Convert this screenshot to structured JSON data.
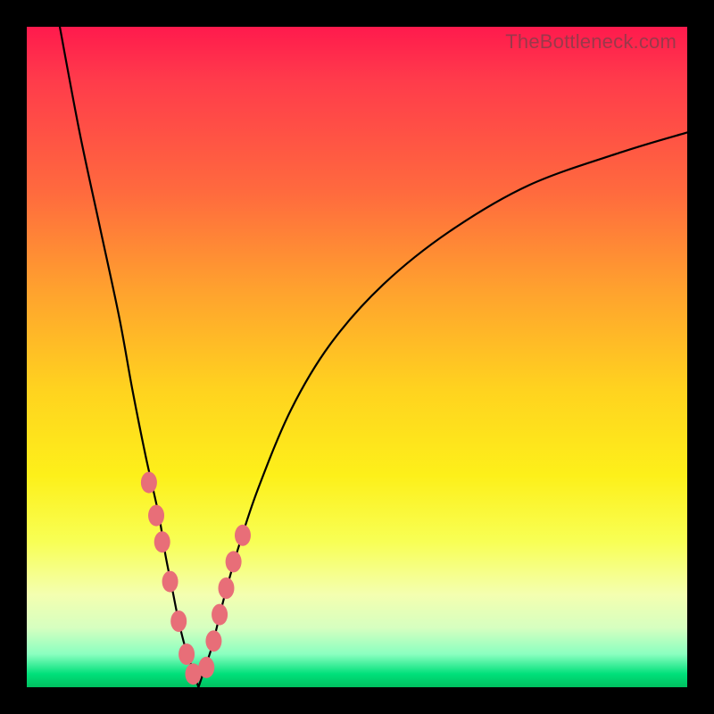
{
  "watermark": "TheBottleneck.com",
  "chart_data": {
    "type": "line",
    "title": "",
    "xlabel": "",
    "ylabel": "",
    "xlim": [
      0,
      100
    ],
    "ylim": [
      0,
      100
    ],
    "grid": false,
    "legend": false,
    "series": [
      {
        "name": "left-branch",
        "x": [
          5,
          8,
          11,
          14,
          16,
          18,
          20,
          21,
          22,
          23,
          24,
          25,
          26
        ],
        "values": [
          100,
          84,
          70,
          56,
          45,
          35,
          26,
          20,
          15,
          10,
          6,
          3,
          0
        ]
      },
      {
        "name": "right-branch",
        "x": [
          26,
          27,
          28,
          29,
          30,
          32,
          35,
          40,
          46,
          54,
          64,
          76,
          90,
          100
        ],
        "values": [
          0,
          3,
          6,
          10,
          14,
          21,
          30,
          42,
          52,
          61,
          69,
          76,
          81,
          84
        ]
      }
    ],
    "markers": [
      {
        "series": "left-branch",
        "x": 18.5,
        "y": 31
      },
      {
        "series": "left-branch",
        "x": 19.6,
        "y": 26
      },
      {
        "series": "left-branch",
        "x": 20.5,
        "y": 22
      },
      {
        "series": "left-branch",
        "x": 21.7,
        "y": 16
      },
      {
        "series": "left-branch",
        "x": 23.0,
        "y": 10
      },
      {
        "series": "left-branch",
        "x": 24.2,
        "y": 5
      },
      {
        "series": "left-branch",
        "x": 25.2,
        "y": 2
      },
      {
        "series": "right-branch",
        "x": 27.2,
        "y": 3
      },
      {
        "series": "right-branch",
        "x": 28.3,
        "y": 7
      },
      {
        "series": "right-branch",
        "x": 29.2,
        "y": 11
      },
      {
        "series": "right-branch",
        "x": 30.2,
        "y": 15
      },
      {
        "series": "right-branch",
        "x": 31.3,
        "y": 19
      },
      {
        "series": "right-branch",
        "x": 32.7,
        "y": 23
      }
    ],
    "marker_color": "#e86e78",
    "line_color": "#000000"
  }
}
